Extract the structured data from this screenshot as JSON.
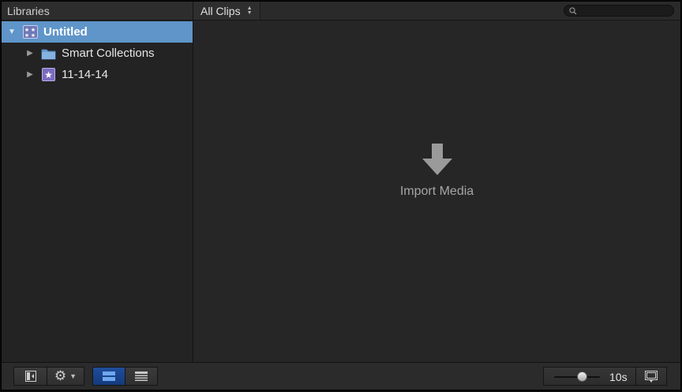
{
  "sidebar": {
    "header": "Libraries",
    "items": [
      {
        "label": "Untitled",
        "icon": "library-icon",
        "expanded": true,
        "selected": true
      },
      {
        "label": "Smart Collections",
        "icon": "folder-icon",
        "expanded": false
      },
      {
        "label": "11-14-14",
        "icon": "event-star-icon",
        "expanded": false
      }
    ]
  },
  "browser": {
    "filter_label": "All Clips",
    "import_label": "Import Media"
  },
  "toolbar": {
    "zoom_value": "10s",
    "zoom_level": 0.6
  },
  "colors": {
    "selection": "#5f95c8",
    "active_button": "#1f4d9c",
    "folder": "#6f9fd3",
    "event": "#7b6bbf"
  }
}
